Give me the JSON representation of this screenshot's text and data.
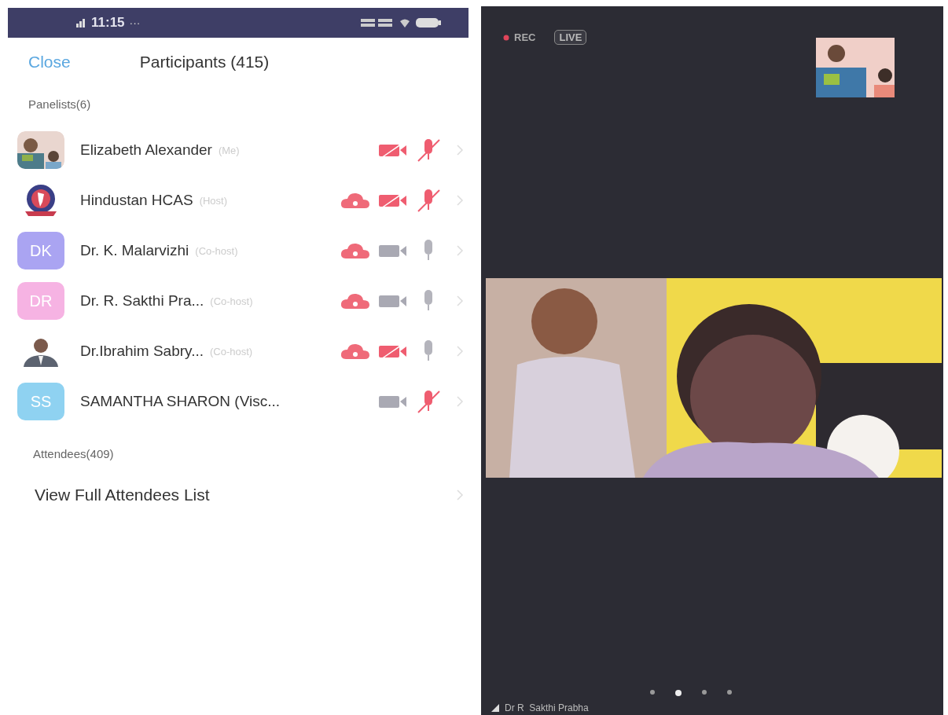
{
  "status_bar": {
    "time": "11:15",
    "more": "···"
  },
  "header": {
    "close": "Close",
    "title": "Participants (415)"
  },
  "panelists": {
    "heading": "Panelists(6)",
    "items": [
      {
        "name": "Elizabeth Alexander",
        "role": "(Me)",
        "cloud": false,
        "video_off": true,
        "muted": true
      },
      {
        "avatar": {
          "kind": "logo"
        },
        "name": "Hindustan HCAS",
        "role": "(Host)",
        "cloud": true,
        "video_off": true,
        "muted": true
      },
      {
        "avatar": {
          "kind": "initials",
          "initials": "DK",
          "color": "#aaa4f2"
        },
        "name": "Dr. K. Malarvizhi",
        "role": "(Co-host)",
        "cloud": true,
        "video_off": false,
        "muted": false
      },
      {
        "avatar": {
          "kind": "initials",
          "initials": "DR",
          "color": "#f6b3e3"
        },
        "name": "Dr. R. Sakthi Pra...",
        "role": "(Co-host)",
        "cloud": true,
        "video_off": false,
        "muted": false
      },
      {
        "avatar": {
          "kind": "portrait"
        },
        "name": "Dr.Ibrahim Sabry...",
        "role": "(Co-host)",
        "cloud": true,
        "video_off": true,
        "muted": false
      },
      {
        "avatar": {
          "kind": "initials",
          "initials": "SS",
          "color": "#8fd2f1"
        },
        "name": "SAMANTHA SHARON (Visc...",
        "cloud": false,
        "video_off": false,
        "muted": true
      }
    ]
  },
  "attendees": {
    "heading": "Attendees(409)",
    "link": "View Full Attendees List"
  },
  "meeting": {
    "rec": "REC",
    "live": "LIVE",
    "speaker": "Dr R  Sakthi Prabha",
    "pages": [
      {
        "selected": false
      },
      {
        "selected": true
      },
      {
        "selected": false
      },
      {
        "selected": false
      }
    ]
  }
}
